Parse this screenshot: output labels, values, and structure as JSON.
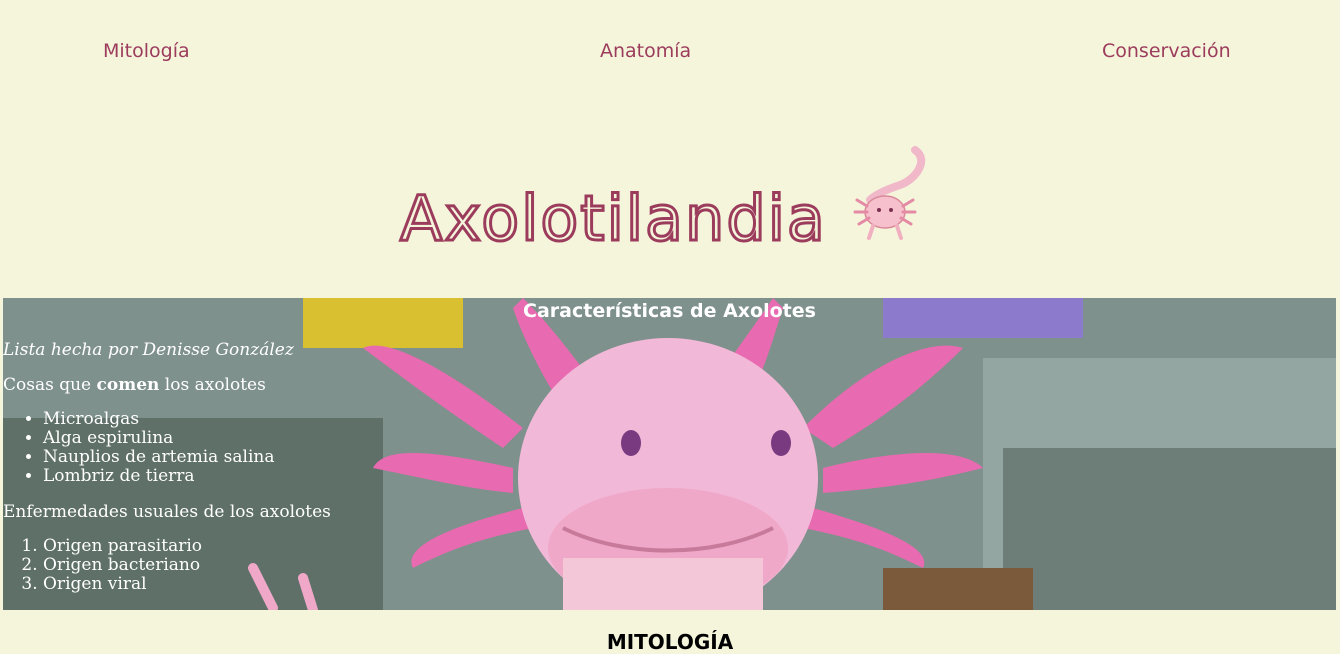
{
  "nav": {
    "items": [
      "Mitología",
      "Anatomía",
      "Conservación"
    ]
  },
  "logo": {
    "text": "Axolotilandia",
    "color": "#9c3c5c"
  },
  "hero": {
    "title": "Características de Axolotes",
    "author": "Lista hecha por Denisse González",
    "food_intro_before": "Cosas que ",
    "food_intro_bold": "comen",
    "food_intro_after": " los axolotes",
    "foods": [
      "Microalgas",
      "Alga espirulina",
      "Nauplios de artemia salina",
      "Lombriz de tierra"
    ],
    "diseases_intro": "Enfermedades usuales de los axolotes",
    "diseases": [
      "Origen parasitario",
      "Origen bacteriano",
      "Origen viral"
    ]
  },
  "section": {
    "title": "MITOLOGÍA"
  },
  "colors": {
    "background": "#f5f5dc",
    "accent": "#9c3c5c",
    "axolotl_pink": "#f0a0c8"
  }
}
